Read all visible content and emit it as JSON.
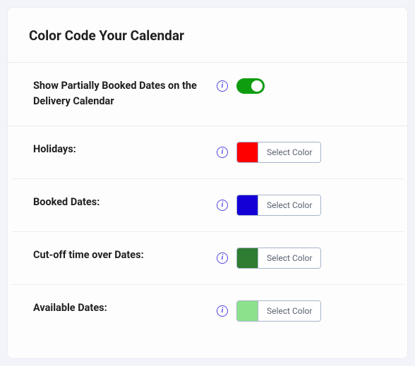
{
  "title": "Color Code Your Calendar",
  "picker_label": "Select Color",
  "rows": {
    "show_partial": {
      "label": "Show Partially Booked Dates on the Delivery Calendar",
      "toggle_on": true
    },
    "holidays": {
      "label": "Holidays:",
      "color": "#ff0000"
    },
    "booked": {
      "label": "Booked Dates:",
      "color": "#1400d6"
    },
    "cutoff": {
      "label": "Cut-off time over Dates:",
      "color": "#2e7d32"
    },
    "available": {
      "label": "Available Dates:",
      "color": "#8ce28c"
    }
  }
}
